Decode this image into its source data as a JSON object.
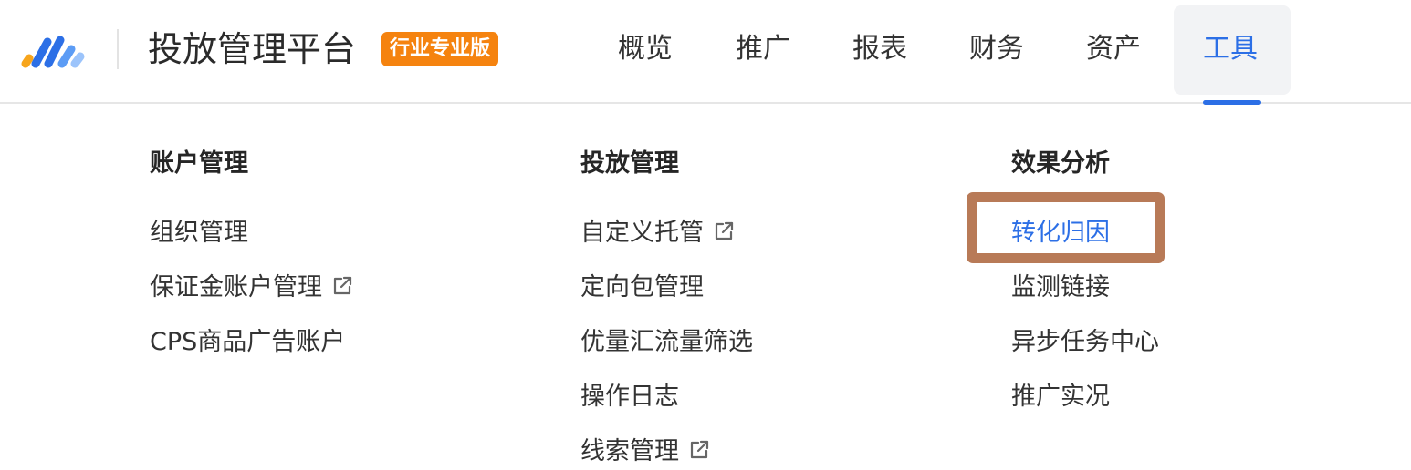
{
  "header": {
    "logo_icon": "brand-stripes-logo",
    "title": "投放管理平台",
    "badge": "行业专业版",
    "badge_color": "#f5830f",
    "nav": [
      {
        "label": "概览",
        "active": false
      },
      {
        "label": "推广",
        "active": false
      },
      {
        "label": "报表",
        "active": false
      },
      {
        "label": "财务",
        "active": false
      },
      {
        "label": "资产",
        "active": false
      },
      {
        "label": "工具",
        "active": true
      }
    ],
    "accent_color": "#2c6fe6"
  },
  "menu": {
    "columns": [
      {
        "heading": "账户管理",
        "items": [
          {
            "label": "组织管理",
            "external": false
          },
          {
            "label": "保证金账户管理",
            "external": true
          },
          {
            "label": "CPS商品广告账户",
            "external": false
          }
        ]
      },
      {
        "heading": "投放管理",
        "items": [
          {
            "label": "自定义托管",
            "external": true
          },
          {
            "label": "定向包管理",
            "external": false
          },
          {
            "label": "优量汇流量筛选",
            "external": false
          },
          {
            "label": "操作日志",
            "external": false
          },
          {
            "label": "线索管理",
            "external": true
          }
        ]
      },
      {
        "heading": "效果分析",
        "items": [
          {
            "label": "转化归因",
            "external": false,
            "highlighted": true
          },
          {
            "label": "监测链接",
            "external": false
          },
          {
            "label": "异步任务中心",
            "external": false
          },
          {
            "label": "推广实况",
            "external": false
          }
        ]
      }
    ],
    "external_icon": "external-link-icon",
    "highlight_color": "#b87a57"
  }
}
